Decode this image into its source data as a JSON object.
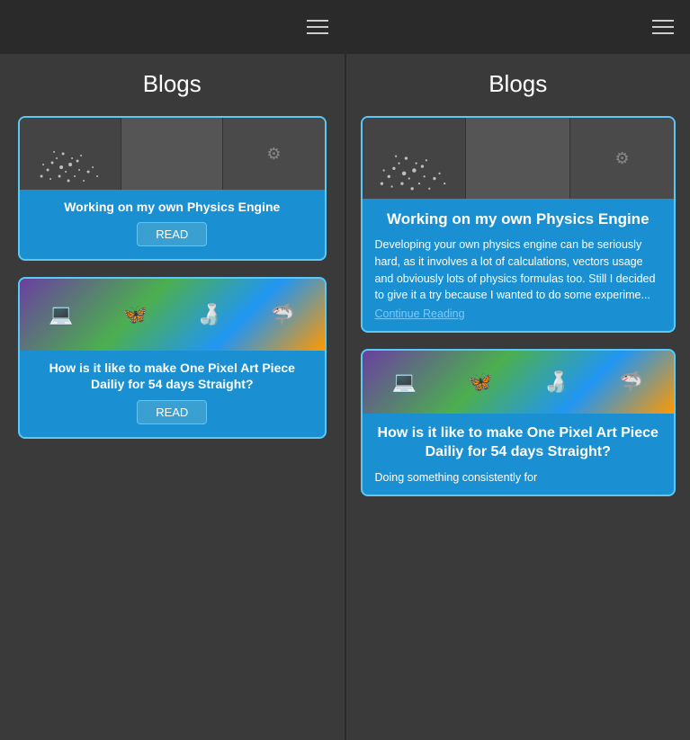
{
  "left_panel": {
    "title": "Blogs",
    "menu_icon": "≡",
    "cards": [
      {
        "id": "physics-engine",
        "title": "Working on my own Physics Engine",
        "button_label": "READ",
        "type": "physics"
      },
      {
        "id": "pixel-art",
        "title": "How is it like to make One Pixel Art Piece Dailiy for 54 days Straight?",
        "button_label": "READ",
        "type": "pixel-art"
      }
    ]
  },
  "right_panel": {
    "title": "Blogs",
    "menu_icon": "≡",
    "expanded_card": {
      "id": "physics-engine",
      "title": "Working on my own Physics Engine",
      "description": "Developing your own physics engine can be seriously hard, as it involves a lot of calculations, vectors usage and obviously lots of physics formulas too. Still I decided to give it a try because I wanted to do some experime...",
      "continue_reading": "Continue Reading",
      "type": "physics"
    },
    "second_card": {
      "id": "pixel-art",
      "title": "How is it like to make One Pixel Art Piece Dailiy for 54 days Straight?",
      "description": "Doing something consistently for",
      "type": "pixel-art"
    }
  },
  "colors": {
    "card_bg": "#1a8fd1",
    "card_border": "#5bc8f5",
    "panel_bg": "#3a3a3a",
    "header_bg": "#2a2a2a",
    "text_white": "#ffffff",
    "link_color": "#7cf"
  }
}
